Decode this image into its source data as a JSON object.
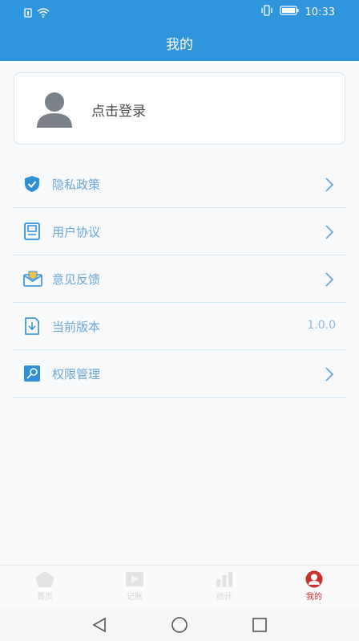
{
  "status": {
    "time": "10:33",
    "left_icons": [
      "sim-icon",
      "wifi-icon"
    ],
    "right_icons": [
      "vibrate-icon",
      "battery-icon"
    ]
  },
  "header": {
    "title": "我的"
  },
  "login": {
    "text": "点击登录",
    "avatar_icon": "avatar-icon"
  },
  "menu": {
    "items": [
      {
        "label": "隐私政策",
        "icon": "shield-check-icon",
        "chevron": true
      },
      {
        "label": "用户协议",
        "icon": "document-icon",
        "chevron": true
      },
      {
        "label": "意见反馈",
        "icon": "mail-icon",
        "chevron": true
      },
      {
        "label": "当前版本",
        "icon": "download-document-icon",
        "value": "1.0.0"
      },
      {
        "label": "权限管理",
        "icon": "key-icon",
        "chevron": true
      }
    ]
  },
  "tabs": [
    {
      "label": "首页",
      "icon": "home-icon",
      "active": false
    },
    {
      "label": "记账",
      "icon": "ledger-icon",
      "active": false
    },
    {
      "label": "统计",
      "icon": "bar-chart-icon",
      "active": false
    },
    {
      "label": "我的",
      "icon": "user-icon",
      "active": true
    }
  ],
  "colors": {
    "primary": "#2f95dd",
    "menu_text": "#6aa8d4",
    "active_tab": "#c9302c",
    "inactive_tab": "#d6d6d6"
  }
}
